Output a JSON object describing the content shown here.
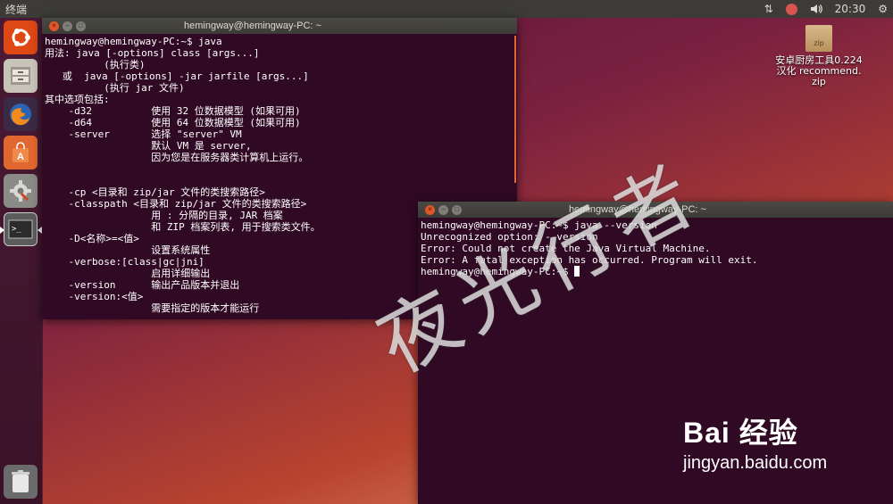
{
  "top_panel": {
    "app_title": "终端",
    "time": "20:30"
  },
  "launcher": {
    "items": [
      "ubuntu-dash",
      "files",
      "firefox",
      "software-center",
      "system-settings",
      "terminal",
      "trash"
    ]
  },
  "desktop": {
    "file_icon_label": "zip",
    "file_name": "安卓厨房工具0.224\n汉化 recommend.\nzip"
  },
  "terminal1": {
    "title": "hemingway@hemingway-PC: ~",
    "lines": [
      "hemingway@hemingway-PC:~$ java",
      "用法: java [-options] class [args...]",
      "          (执行类)",
      "   或  java [-options] -jar jarfile [args...]",
      "          (执行 jar 文件)",
      "其中选项包括:",
      "    -d32          使用 32 位数据模型 (如果可用)",
      "    -d64          使用 64 位数据模型 (如果可用)",
      "    -server       选择 \"server\" VM",
      "                  默认 VM 是 server,",
      "                  因为您是在服务器类计算机上运行。",
      "",
      "",
      "    -cp <目录和 zip/jar 文件的类搜索路径>",
      "    -classpath <目录和 zip/jar 文件的类搜索路径>",
      "                  用 : 分隔的目录, JAR 档案",
      "                  和 ZIP 档案列表, 用于搜索类文件。",
      "    -D<名称>=<值>",
      "                  设置系统属性",
      "    -verbose:[class|gc|jni]",
      "                  启用详细输出",
      "    -version      输出产品版本并退出",
      "    -version:<值>",
      "                  需要指定的版本才能运行"
    ]
  },
  "terminal2": {
    "title": "hemingway@hemingway-PC: ~",
    "lines": [
      "hemingway@hemingway-PC:~$ java --version",
      "Unrecognized option: --version",
      "Error: Could not create the Java Virtual Machine.",
      "Error: A fatal exception has occurred. Program will exit."
    ],
    "prompt": "hemingway@hemingway-PC:~$ "
  },
  "watermark": {
    "text": "夜光行者",
    "baidu_logo": "Bai 经验",
    "baidu_url": "jingyan.baidu.com"
  }
}
